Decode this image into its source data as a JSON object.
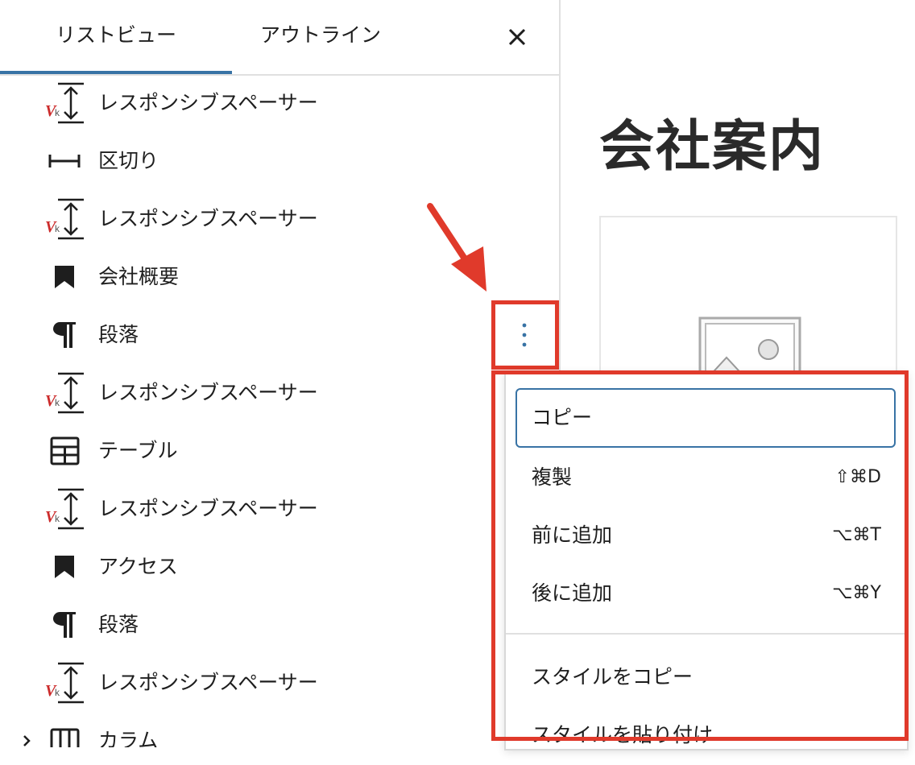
{
  "tabs": {
    "list_view": "リストビュー",
    "outline": "アウトライン"
  },
  "blocks": [
    {
      "label": "レスポンシブスペーサー",
      "icon": "spacer-icon"
    },
    {
      "label": "区切り",
      "icon": "separator-icon"
    },
    {
      "label": "レスポンシブスペーサー",
      "icon": "spacer-icon"
    },
    {
      "label": "会社概要",
      "icon": "bookmark-icon"
    },
    {
      "label": "段落",
      "icon": "paragraph-icon"
    },
    {
      "label": "レスポンシブスペーサー",
      "icon": "spacer-icon"
    },
    {
      "label": "テーブル",
      "icon": "table-icon"
    },
    {
      "label": "レスポンシブスペーサー",
      "icon": "spacer-icon"
    },
    {
      "label": "アクセス",
      "icon": "bookmark-icon"
    },
    {
      "label": "段落",
      "icon": "paragraph-icon"
    },
    {
      "label": "レスポンシブスペーサー",
      "icon": "spacer-icon"
    },
    {
      "label": "カラム",
      "icon": "columns-icon"
    }
  ],
  "page": {
    "title": "会社案内"
  },
  "menu": {
    "items": [
      {
        "label": "コピー",
        "shortcut": ""
      },
      {
        "label": "複製",
        "shortcut": "⇧⌘D"
      },
      {
        "label": "前に追加",
        "shortcut": "⌥⌘T"
      },
      {
        "label": "後に追加",
        "shortcut": "⌥⌘Y"
      },
      {
        "label": "スタイルをコピー",
        "shortcut": ""
      },
      {
        "label": "スタイルを貼り付け",
        "shortcut": ""
      }
    ]
  },
  "colors": {
    "accent": "#3873a5",
    "annotation_red": "#e03a2b",
    "spacer_logo_red": "#cc2b2b"
  }
}
